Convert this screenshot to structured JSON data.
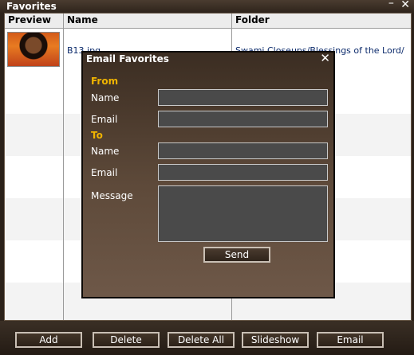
{
  "window": {
    "title": "Favorites",
    "minimize_glyph": "–",
    "close_glyph": "✕"
  },
  "table": {
    "columns": [
      "Preview",
      "Name",
      "Folder"
    ],
    "rows": [
      {
        "preview": "thumbnail-image",
        "name": "B13.jpg",
        "folder": "Swami Closeups/Blessings of the Lord/"
      }
    ]
  },
  "buttons": {
    "add": "Add",
    "delete": "Delete",
    "delete_all": "Delete All",
    "slideshow": "Slideshow",
    "email": "Email"
  },
  "dialog": {
    "title": "Email Favorites",
    "close_glyph": "✕",
    "from_label": "From",
    "from_name_label": "Name",
    "from_email_label": "Email",
    "to_label": "To",
    "to_name_label": "Name",
    "to_email_label": "Email",
    "message_label": "Message",
    "from_name_value": "",
    "from_email_value": "",
    "to_name_value": "",
    "to_email_value": "",
    "message_value": "",
    "send_label": "Send"
  },
  "colors": {
    "section_label": "#f0b400",
    "window_bg": "#2b2119",
    "field_bg": "#4a4a4a"
  }
}
